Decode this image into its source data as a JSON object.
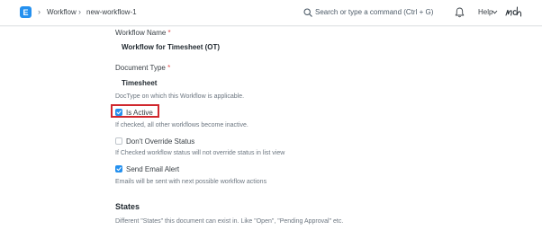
{
  "navbar": {
    "logo_letter": "E",
    "breadcrumbs": [
      "Workflow",
      "new-workflow-1"
    ],
    "search_placeholder": "Search or type a command (Ctrl + G)",
    "help_label": "Help",
    "avatar_text": "nch"
  },
  "form": {
    "workflow_name": {
      "label": "Workflow Name",
      "required": "*",
      "value": "Workflow for Timesheet (OT)"
    },
    "document_type": {
      "label": "Document Type",
      "required": "*",
      "value": "Timesheet",
      "description": "DocType on which this Workflow is applicable."
    },
    "is_active": {
      "label": "Is Active",
      "checked": true,
      "description": "If checked, all other workflows become inactive."
    },
    "dont_override_status": {
      "label": "Don't Override Status",
      "checked": false,
      "description": "If Checked workflow status will not override status in list view"
    },
    "send_email_alert": {
      "label": "Send Email Alert",
      "checked": true,
      "description": "Emails will be sent with next possible workflow actions"
    }
  },
  "states_section": {
    "title": "States",
    "description": "Different \"States\" this document can exist in. Like \"Open\", \"Pending Approval\" etc."
  },
  "colors": {
    "accent": "#2490ef",
    "highlight": "#d0282e",
    "required": "#e24c4c"
  }
}
